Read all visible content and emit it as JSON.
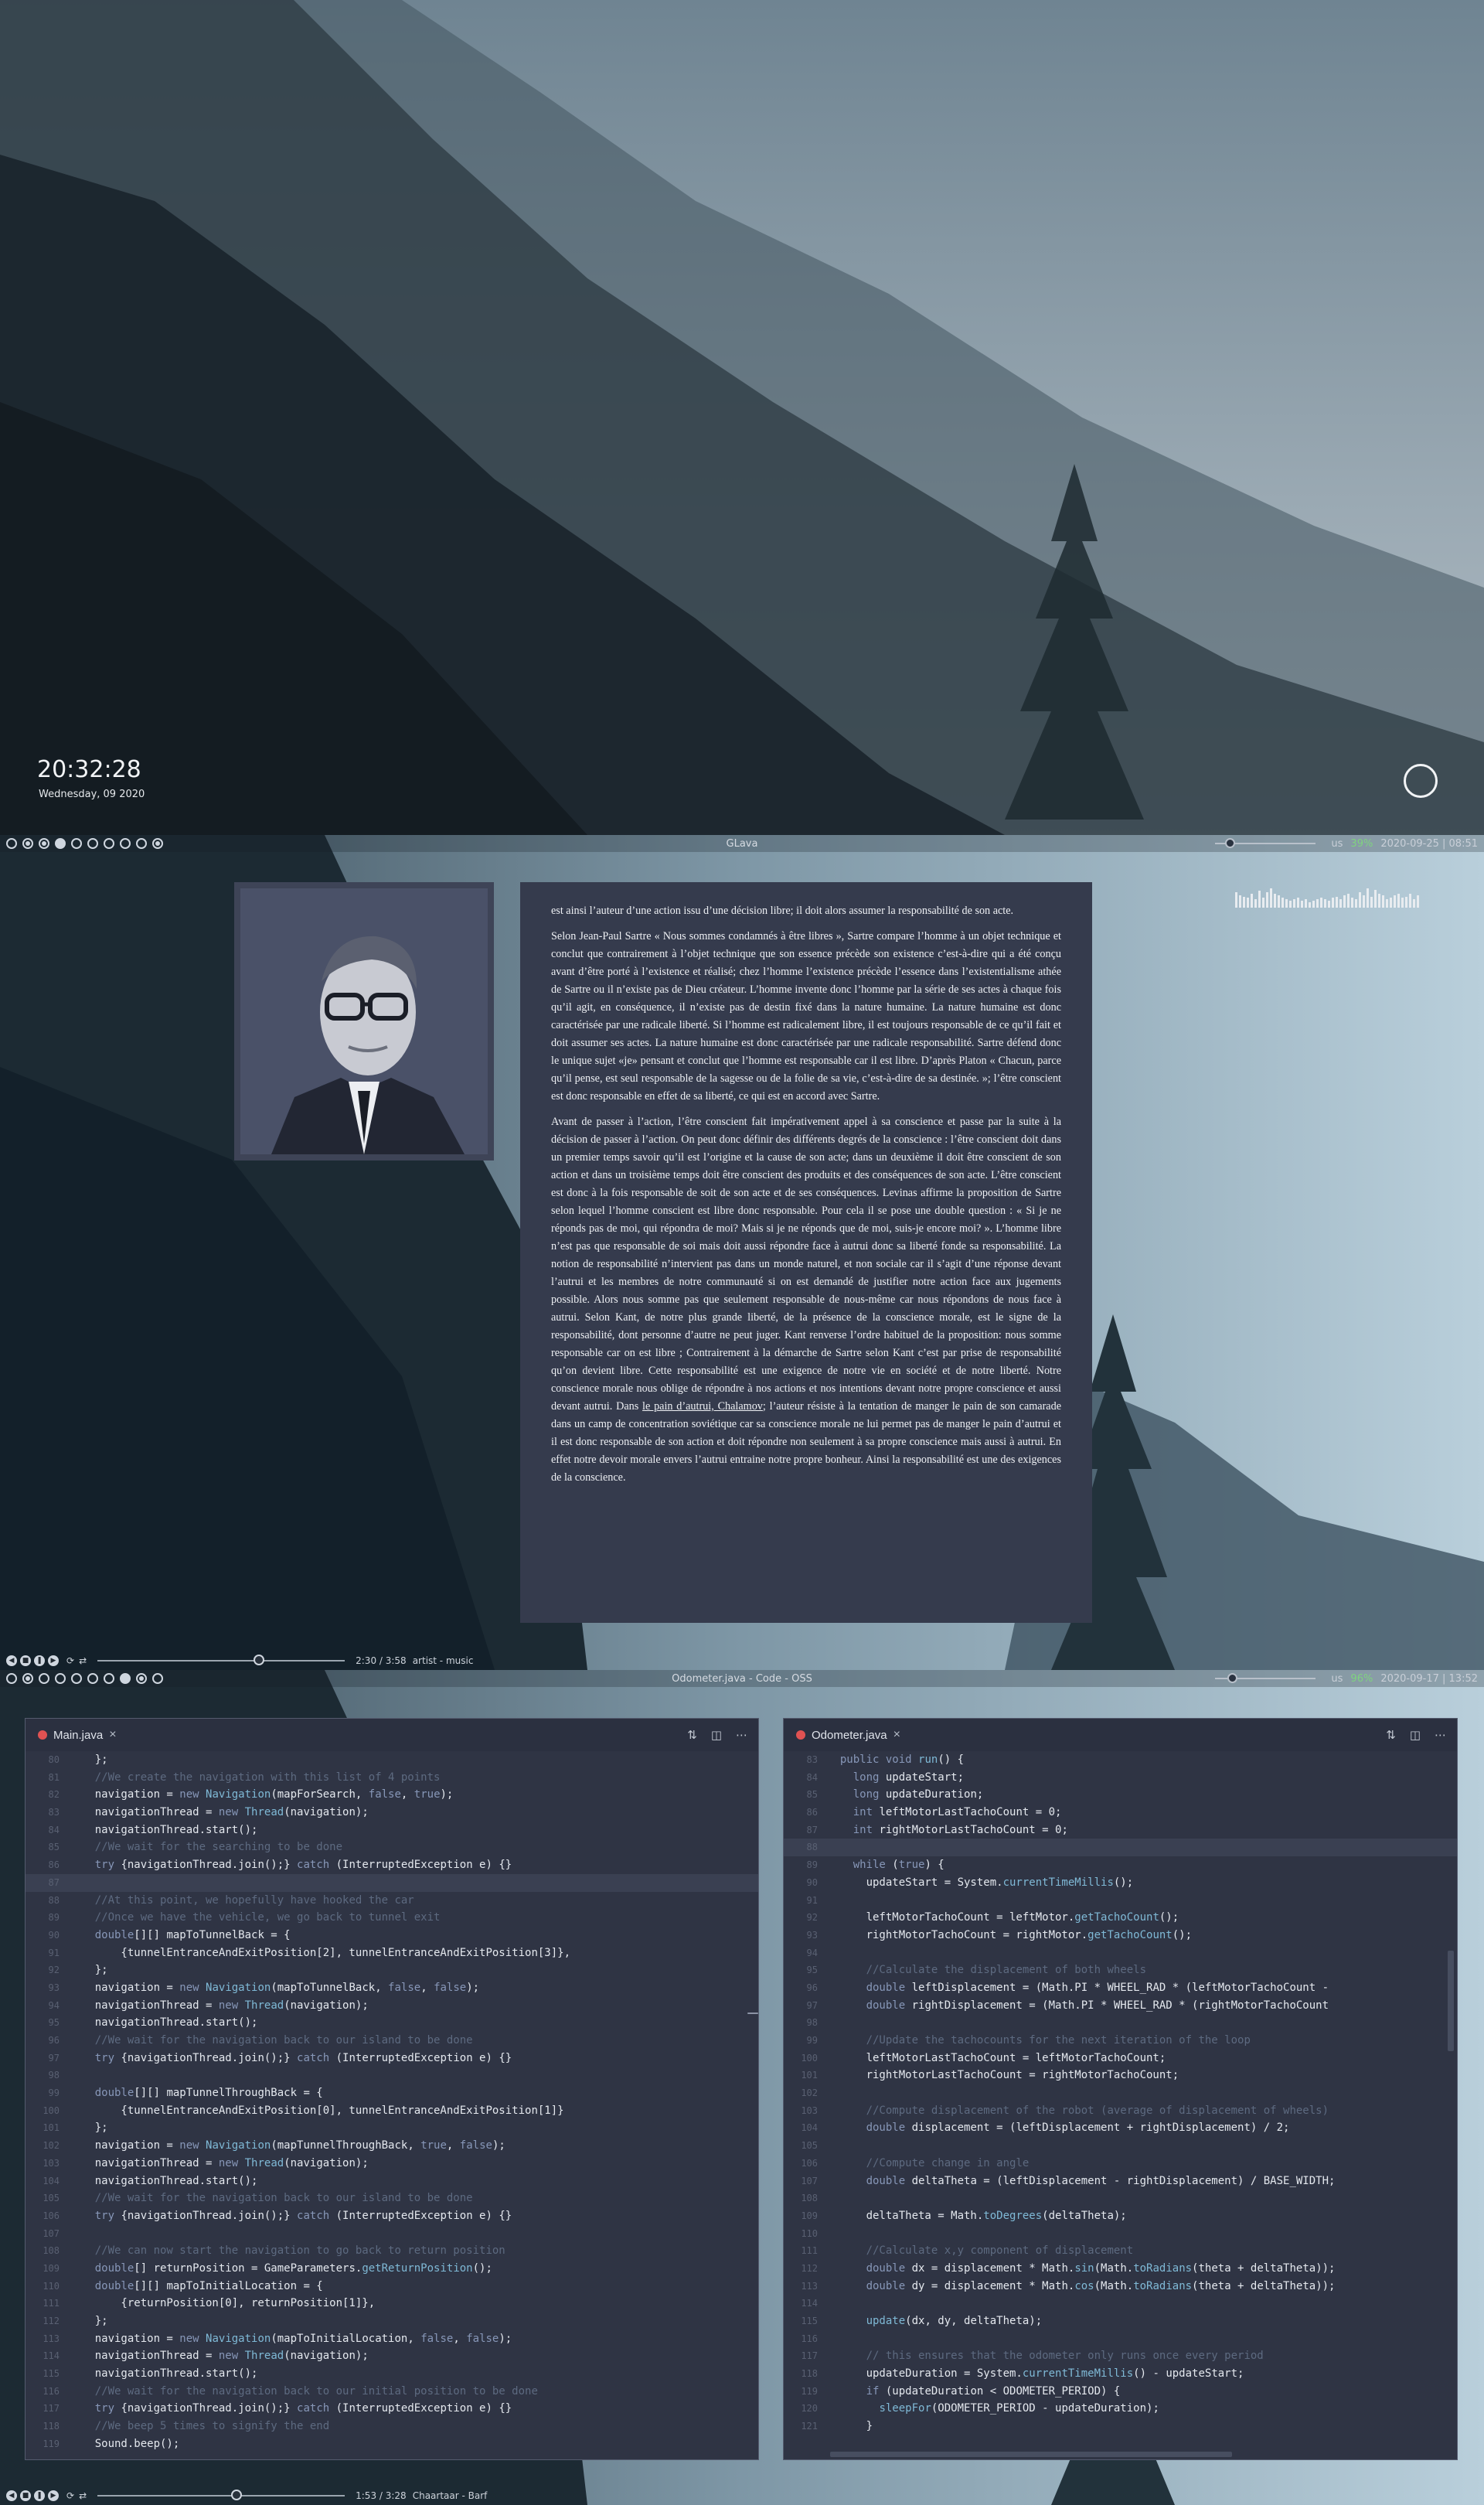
{
  "screen1": {
    "clock": "20:32:28",
    "date": "Wednesday, 09 2020"
  },
  "screen2": {
    "window_title": "GLava",
    "status": {
      "locale": "us",
      "battery": "39%",
      "datetime": "2020-09-25 | 08:51"
    },
    "player": {
      "time": "2:30 / 3:58",
      "track": "artist - music",
      "progress": 0.63
    },
    "volume": 0.1,
    "document": {
      "paragraphs": [
        "est ainsi l’auteur d’une action issu d’une décision libre; il doit alors assumer la responsabilité de son acte.",
        "Selon Jean-Paul Sartre « Nous sommes condamnés à être libres », Sartre compare l’homme à un objet technique et conclut que contrairement à l’objet technique que son essence précède son existence c’est-à-dire qui a été conçu avant d’être porté à l’existence et réalisé; chez l’homme l’existence précède l’essence dans l’existentialisme athée de Sartre ou il n’existe pas de Dieu créateur. L’homme invente donc l’homme par la série de ses actes à chaque fois qu’il agit, en conséquence, il n’existe pas de destin fixé dans la nature humaine. La nature humaine est donc caractérisée par une radicale liberté. Si l’homme est radicalement libre, il est toujours responsable de ce qu’il fait et doit assumer ses actes. La nature humaine est donc caractérisée par une radicale responsabilité. Sartre défend donc le unique sujet «je» pensant et conclut que l’homme est responsable car il est libre. D’après Platon « Chacun, parce qu’il pense, est seul responsable de la sagesse ou de la folie de sa vie, c’est-à-dire de sa destinée. »; l’être conscient est donc responsable en effet de sa liberté, ce qui est en accord avec Sartre.",
        "Avant de passer à l’action, l’être conscient fait impérativement appel à sa conscience et passe par la suite à la décision de passer à l’action. On peut donc définir des différents degrés de la conscience : l’être conscient doit dans un premier temps savoir qu’il est l’origine et la cause de son acte; dans un deuxième il doit être conscient de son action et dans un troisième temps doit être conscient des produits et des conséquences de son acte. L’être conscient est donc à la fois responsable de soit de son acte et de ses conséquences. Levinas affirme la proposition de Sartre selon lequel l’homme conscient est libre donc responsable. Pour cela il se pose une double question : « Si je ne réponds pas de moi, qui répondra de moi? Mais si je ne réponds que de moi, suis-je encore moi? ». L’homme libre n’est pas que responsable de soi mais doit aussi répondre face à autrui donc sa liberté fonde sa responsabilité. La notion de responsabilité n’intervient pas dans un monde naturel, et non sociale car il s’agit d’une réponse devant l’autrui et les membres de notre communauté si on est demandé de justifier notre action face aux jugements possible. Alors nous somme pas que seulement responsable de nous-même car nous répondons de nous face à autrui. Selon Kant, de notre plus grande liberté, de la présence de la conscience morale, est le signe de la responsabilité, dont personne d’autre ne peut juger. Kant renverse l’ordre habituel de la proposition: nous somme responsable car on est libre ; Contrairement à la démarche de Sartre selon Kant c’est par prise de responsabilité qu’on devient libre. Cette responsabilité est une exigence de notre vie en société et de notre liberté. Notre conscience morale nous oblige de répondre à nos actions et nos intentions devant notre propre conscience et aussi devant autrui."
      ],
      "last_paragraph_before": "Dans ",
      "last_paragraph_link": "le pain d’autrui, Chalamov",
      "last_paragraph_after": "; l’auteur résiste à la tentation de manger le pain de son camarade dans un camp de concentration soviétique car sa conscience morale ne lui permet pas de manger le pain d’autrui et il est donc responsable de son action et doit répondre non seulement à sa propre conscience mais aussi à autrui. En effet notre devoir morale envers l’autrui entraine notre propre bonheur. Ainsi la responsabilité est une des exigences de la conscience."
    }
  },
  "screen3": {
    "window_title": "Odometer.java - Code - OSS",
    "status": {
      "locale": "us",
      "battery": "96%",
      "datetime": "2020-09-17 | 13:52"
    },
    "player": {
      "time": "1:53 / 3:28",
      "track": "Chaartaar - Barf",
      "progress": 0.54
    },
    "volume": 0.12,
    "editor_left": {
      "tab": "Main.java",
      "first_line": 80,
      "lines": [
        "    };",
        "    //We create the navigation with this list of 4 points",
        "    navigation = new Navigation(mapForSearch, false, true);",
        "    navigationThread = new Thread(navigation);",
        "    navigationThread.start();",
        "    //We wait for the searching to be done",
        "    try {navigationThread.join();} catch (InterruptedException e) {}",
        "",
        "    //At this point, we hopefully have hooked the car",
        "    //Once we have the vehicle, we go back to tunnel exit",
        "    double[][] mapToTunnelBack = {",
        "        {tunnelEntranceAndExitPosition[2], tunnelEntranceAndExitPosition[3]},",
        "    };",
        "    navigation = new Navigation(mapToTunnelBack, false, false);",
        "    navigationThread = new Thread(navigation);",
        "    navigationThread.start();",
        "    //We wait for the navigation back to our island to be done",
        "    try {navigationThread.join();} catch (InterruptedException e) {}",
        "",
        "    double[][] mapTunnelThroughBack = {",
        "        {tunnelEntranceAndExitPosition[0], tunnelEntranceAndExitPosition[1]}",
        "    };",
        "    navigation = new Navigation(mapTunnelThroughBack, true, false);",
        "    navigationThread = new Thread(navigation);",
        "    navigationThread.start();",
        "    //We wait for the navigation back to our island to be done",
        "    try {navigationThread.join();} catch (InterruptedException e) {}",
        "",
        "    //We can now start the navigation to go back to return position",
        "    double[] returnPosition = GameParameters.getReturnPosition();",
        "    double[][] mapToInitialLocation = {",
        "        {returnPosition[0], returnPosition[1]},",
        "    };",
        "    navigation = new Navigation(mapToInitialLocation, false, false);",
        "    navigationThread = new Thread(navigation);",
        "    navigationThread.start();",
        "    //We wait for the navigation back to our initial position to be done",
        "    try {navigationThread.join();} catch (InterruptedException e) {}",
        "    //We beep 5 times to signify the end",
        "    Sound.beep();"
      ],
      "highlight_index": 7
    },
    "editor_right": {
      "tab": "Odometer.java",
      "first_line": 83,
      "lines": [
        "  public void run() {",
        "    long updateStart;",
        "    long updateDuration;",
        "    int leftMotorLastTachoCount = 0;",
        "    int rightMotorLastTachoCount = 0;",
        "",
        "    while (true) {",
        "      updateStart = System.currentTimeMillis();",
        "",
        "      leftMotorTachoCount = leftMotor.getTachoCount();",
        "      rightMotorTachoCount = rightMotor.getTachoCount();",
        "",
        "      //Calculate the displacement of both wheels",
        "      double leftDisplacement = (Math.PI * WHEEL_RAD * (leftMotorTachoCount -",
        "      double rightDisplacement = (Math.PI * WHEEL_RAD * (rightMotorTachoCount",
        "",
        "      //Update the tachocounts for the next iteration of the loop",
        "      leftMotorLastTachoCount = leftMotorTachoCount;",
        "      rightMotorLastTachoCount = rightMotorTachoCount;",
        "",
        "      //Compute displacement of the robot (average of displacement of wheels)",
        "      double displacement = (leftDisplacement + rightDisplacement) / 2;",
        "",
        "      //Compute change in angle",
        "      double deltaTheta = (leftDisplacement - rightDisplacement) / BASE_WIDTH;",
        "",
        "      deltaTheta = Math.toDegrees(deltaTheta);",
        "",
        "      //Calculate x,y component of displacement",
        "      double dx = displacement * Math.sin(Math.toRadians(theta + deltaTheta));",
        "      double dy = displacement * Math.cos(Math.toRadians(theta + deltaTheta));",
        "",
        "      update(dx, dy, deltaTheta);",
        "",
        "      // this ensures that the odometer only runs once every period",
        "      updateDuration = System.currentTimeMillis() - updateStart;",
        "      if (updateDuration < ODOMETER_PERIOD) {",
        "        sleepFor(ODOMETER_PERIOD - updateDuration);",
        "      }"
      ],
      "highlight_index": 5
    }
  },
  "visualizer_levels": [
    0.55,
    0.45,
    0.4,
    0.35,
    0.5,
    0.3,
    0.6,
    0.35,
    0.55,
    0.7,
    0.5,
    0.45,
    0.35,
    0.3,
    0.25,
    0.3,
    0.35,
    0.25,
    0.3,
    0.2,
    0.25,
    0.3,
    0.35,
    0.3,
    0.25,
    0.35,
    0.4,
    0.3,
    0.45,
    0.5,
    0.35,
    0.3,
    0.55,
    0.45,
    0.7,
    0.4,
    0.65,
    0.5,
    0.45,
    0.3,
    0.35,
    0.45,
    0.5,
    0.35,
    0.4,
    0.5,
    0.3,
    0.45
  ]
}
